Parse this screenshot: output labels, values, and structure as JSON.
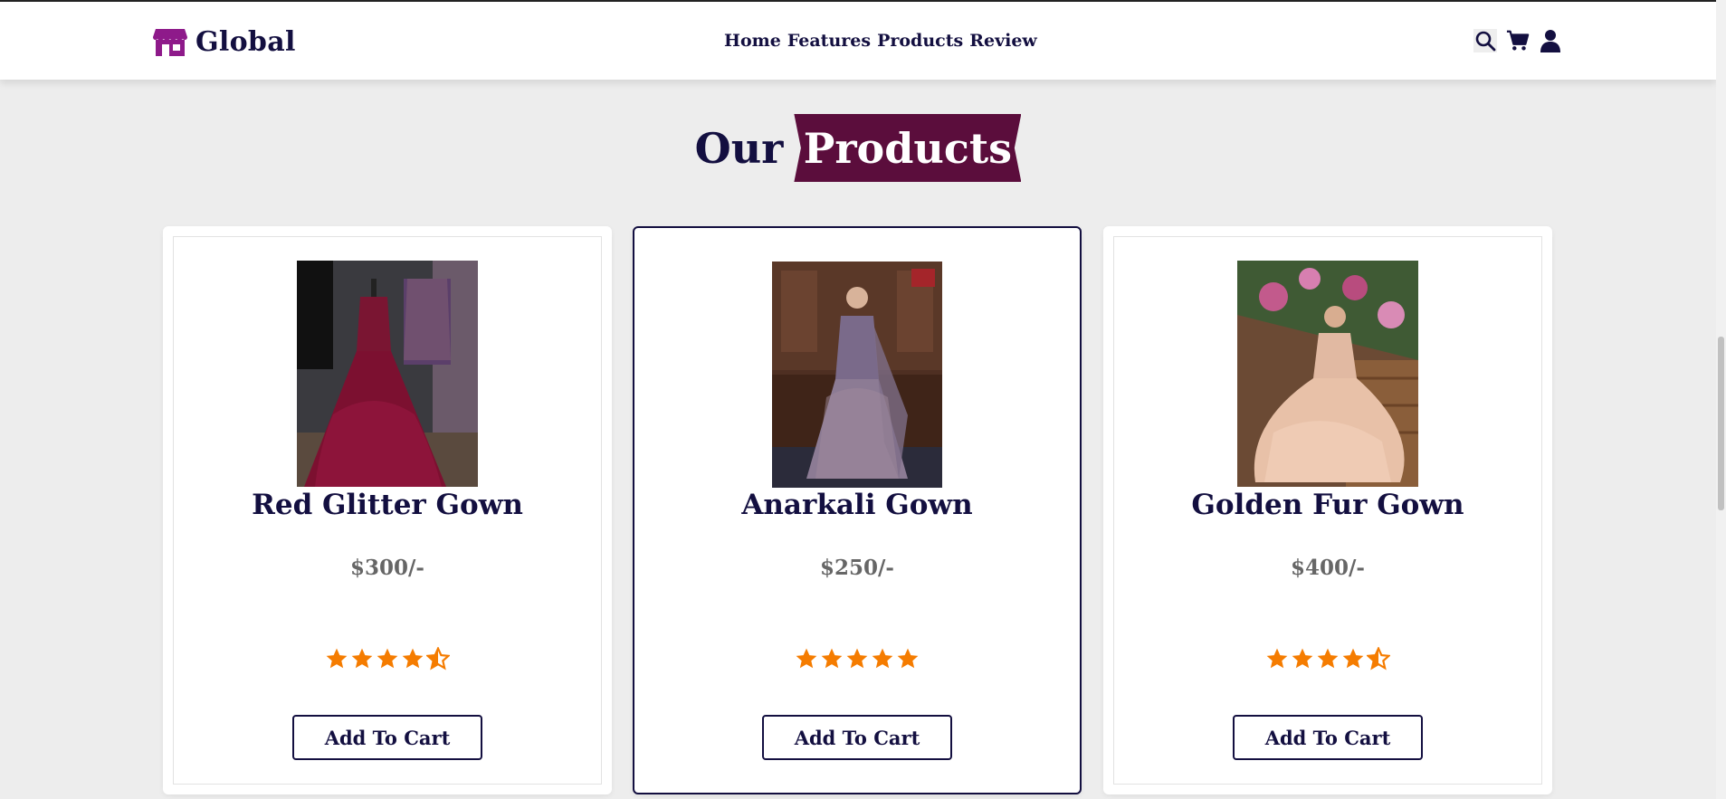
{
  "header": {
    "logo_text": "Global",
    "logo_icon": "store-icon",
    "nav": [
      "Home",
      "Features",
      "Products",
      "Review"
    ],
    "icons": [
      "search-icon",
      "cart-icon",
      "user-icon"
    ]
  },
  "section": {
    "heading_plain": "Our",
    "heading_highlight": "Products"
  },
  "products": [
    {
      "name": "Red Glitter Gown",
      "price": "$300/-",
      "rating": 4.5,
      "button": "Add To Cart"
    },
    {
      "name": "Anarkali Gown",
      "price": "$250/-",
      "rating": 5,
      "button": "Add To Cart"
    },
    {
      "name": "Golden Fur Gown",
      "price": "$400/-",
      "rating": 4.5,
      "button": "Add To Cart"
    }
  ],
  "colors": {
    "brand": "#130f40",
    "accent": "#5b0d3c",
    "logo_purple": "#8e1a8a",
    "star": "#f57c00"
  }
}
